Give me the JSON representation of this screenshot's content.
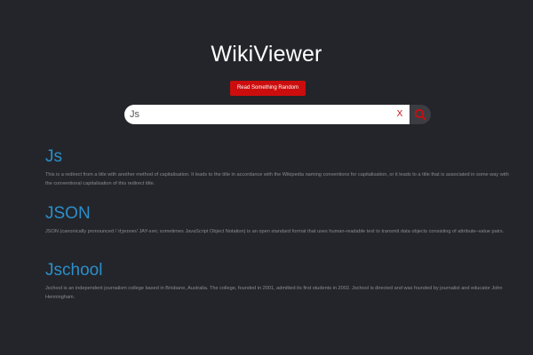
{
  "app": {
    "title": "WikiViewer",
    "random_button_label": "Read Something Random"
  },
  "search": {
    "value": "Js",
    "placeholder": "",
    "clear_label": "X"
  },
  "colors": {
    "background": "#24252a",
    "accent_red": "#cc0d0d",
    "link_blue": "#2b8fcb",
    "snippet_gray": "#8a8b90"
  },
  "results": [
    {
      "title": "Js",
      "snippet": "This is a redirect from a title with another method of capitalisation. It leads to the title in accordance with the Wikipedia naming conventions for capitalisation, or it leads to a title that is associated in some way with the conventional capitalisation of this redirect title."
    },
    {
      "title": "JSON",
      "snippet": "JSON (canonically pronounced /ˈdʒeɪsən/ JAY-sən; sometimes JavaScript Object Notation) is an open standard format that uses human-readable text to transmit data objects consisting of attribute–value pairs."
    },
    {
      "title": "Jschool",
      "snippet": "Jschool is an independent journalism college based in Brisbane, Australia. The college, founded in 2001, admitted its first students in 2002. Jschool is directed and was founded by journalist and educator John Henningham."
    }
  ]
}
